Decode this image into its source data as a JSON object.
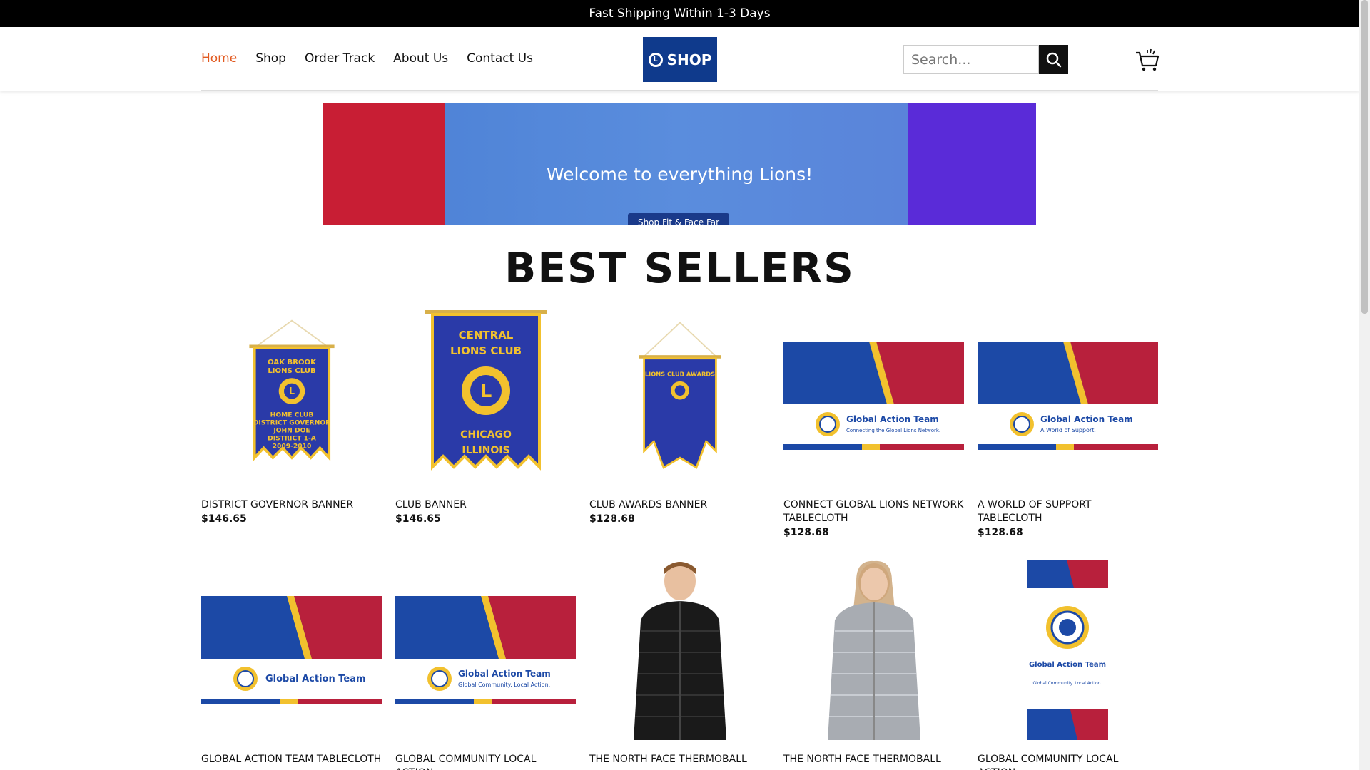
{
  "topbar": {
    "text": "Fast Shipping Within 1-3 Days"
  },
  "nav": {
    "items": [
      "Home",
      "Shop",
      "Order Track",
      "About Us",
      "Contact Us"
    ],
    "active_index": 0
  },
  "logo": {
    "text": "SHOP"
  },
  "search": {
    "placeholder": "Search..."
  },
  "hero": {
    "message": "Welcome to everything Lions!",
    "button_label": "Shop Fit & Face Far"
  },
  "section": {
    "title": "BEST SELLERS"
  },
  "products": [
    {
      "name": "DISTRICT GOVERNOR BANNER",
      "price": "$146.65",
      "image": "pennant",
      "pennant_text": [
        "OAK BROOK",
        "LIONS CLUB",
        "HOME CLUB",
        "DISTRICT GOVERNOR",
        "JOHN DOE",
        "DISTRICT 1-A",
        "2009-2010"
      ]
    },
    {
      "name": "CLUB BANNER",
      "price": "$146.65",
      "image": "pennant",
      "pennant_text": [
        "CENTRAL",
        "LIONS CLUB",
        "CHICAGO",
        "ILLINOIS"
      ]
    },
    {
      "name": "CLUB AWARDS BANNER",
      "price": "$128.68",
      "image": "pennant",
      "pennant_text": [
        "LIONS CLUB AWARDS"
      ]
    },
    {
      "name": "CONNECT GLOBAL LIONS NETWORK TABLECLOTH",
      "price": "$128.68",
      "image": "tablecloth",
      "tag": "Global Action Team",
      "subtag": "Connecting the Global Lions Network."
    },
    {
      "name": "A WORLD OF SUPPORT TABLECLOTH",
      "price": "$128.68",
      "image": "tablecloth",
      "tag": "Global Action Team",
      "subtag": "A World of Support."
    },
    {
      "name": "GLOBAL ACTION TEAM TABLECLOTH",
      "price": "",
      "image": "tablecloth",
      "tag": "Global Action Team",
      "subtag": ""
    },
    {
      "name": "GLOBAL COMMUNITY LOCAL ACTION",
      "price": "",
      "image": "tablecloth",
      "tag": "Global Action Team",
      "subtag": "Global Community. Local Action."
    },
    {
      "name": "THE NORTH FACE THERMOBALL",
      "price": "",
      "image": "jacket-black"
    },
    {
      "name": "THE NORTH FACE THERMOBALL",
      "price": "",
      "image": "jacket-grey"
    },
    {
      "name": "GLOBAL COMMUNITY LOCAL ACTION",
      "price": "",
      "image": "banner-vertical",
      "tag": "Global Action Team",
      "subtag": "Global Community. Local Action."
    }
  ],
  "colors": {
    "accent": "#e2591f",
    "brand_blue": "#0f3a8c",
    "pennant_blue": "#2a3aa8",
    "gold": "#f2c12e",
    "red": "#b8203c"
  }
}
